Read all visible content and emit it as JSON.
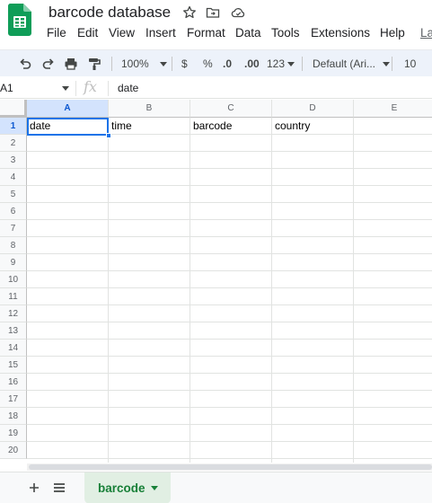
{
  "document": {
    "title": "barcode database",
    "star_icon": "star-outline-icon",
    "move_icon": "folder-move-icon",
    "status_icon": "cloud-saved-icon"
  },
  "menu": {
    "items": [
      "File",
      "Edit",
      "View",
      "Insert",
      "Format",
      "Data",
      "Tools",
      "Extensions",
      "Help",
      "La"
    ]
  },
  "toolbar": {
    "zoom": "100%",
    "currency": "$",
    "percent": "%",
    "decrease_decimals": ".0",
    "increase_decimals": ".00",
    "more_formats": "123",
    "font": "Default (Ari...",
    "font_size": "10"
  },
  "formula_bar": {
    "cell_ref": "A1",
    "fx_label": "fx",
    "value": "date"
  },
  "grid": {
    "columns": [
      "A",
      "B",
      "C",
      "D",
      "E"
    ],
    "rows": [
      "1",
      "2",
      "3",
      "4",
      "5",
      "6",
      "7",
      "8",
      "9",
      "10",
      "11",
      "12",
      "13",
      "14",
      "15",
      "16",
      "17",
      "18",
      "19",
      "20"
    ],
    "row1": [
      "date",
      "time",
      "barcode",
      "country",
      ""
    ],
    "selected_cell": "A1"
  },
  "sheets": {
    "active_tab": "barcode"
  },
  "colors": {
    "accent": "#1a73e8",
    "sheets_green": "#188038",
    "toolbar_bg": "#edf2fa"
  }
}
